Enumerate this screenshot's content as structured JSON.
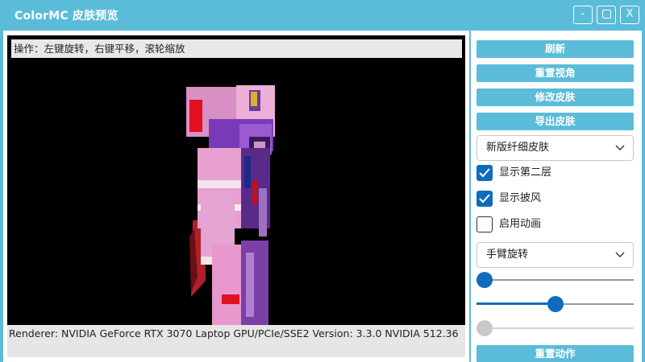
{
  "window": {
    "title": "ColorMC 皮肤预览",
    "min_label": "-",
    "close_label": "X"
  },
  "viewport": {
    "hint": "操作：左键旋转，右键平移，滚轮缩放",
    "renderer": "Renderer: NVIDIA GeForce RTX 3070 Laptop GPU/PCIe/SSE2 Version: 3.3.0 NVIDIA 512.36"
  },
  "sidebar": {
    "buttons": {
      "refresh": "刷新",
      "reset_view": "重置视角",
      "edit_skin": "修改皮肤",
      "export_skin": "导出皮肤",
      "reset_action": "重置动作"
    },
    "model_select": {
      "value": "新版纤细皮肤"
    },
    "checkboxes": [
      {
        "label": "显示第二层",
        "checked": true
      },
      {
        "label": "显示披风",
        "checked": true
      },
      {
        "label": "启用动画",
        "checked": false
      }
    ],
    "pose_select": {
      "value": "手臂旋转"
    },
    "sliders": [
      {
        "value": 0,
        "enabled": true
      },
      {
        "value": 0.5,
        "enabled": true
      },
      {
        "value": 0,
        "enabled": false
      }
    ]
  },
  "colors": {
    "accent": "#5bbcd9",
    "control_blue": "#0f6cbd"
  }
}
